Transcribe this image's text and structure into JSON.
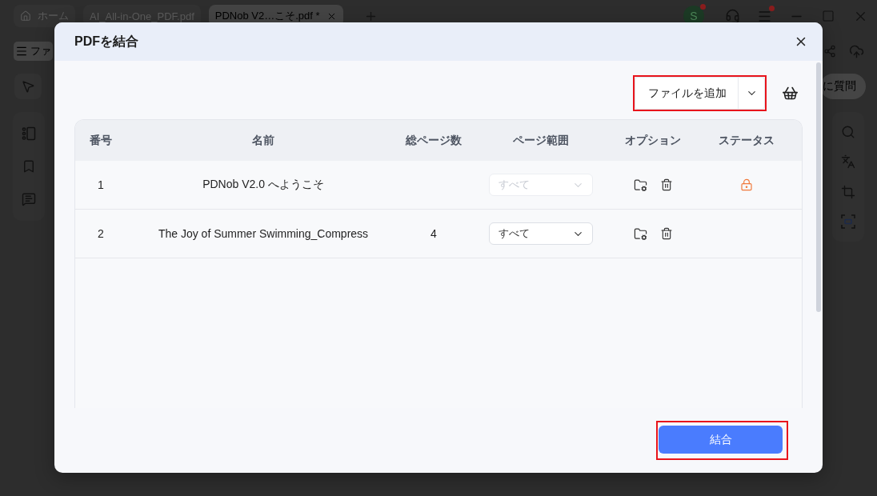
{
  "app": {
    "tabs": [
      {
        "label": "ホーム",
        "kind": "home",
        "selected": false
      },
      {
        "label": "AI_All-in-One_PDF.pdf",
        "kind": "file",
        "selected": false
      },
      {
        "label": "PDNob V2…こそ.pdf *",
        "kind": "file",
        "selected": true
      }
    ],
    "account": {
      "initial": "S",
      "notification": true
    },
    "menu_notification": true,
    "file_menu": {
      "label": "ファ"
    },
    "ask_button": {
      "label": "に質問"
    }
  },
  "dialog": {
    "title": "PDFを結合",
    "add_files": {
      "label": "ファイルを追加",
      "highlighted": true
    },
    "table": {
      "columns": [
        "番号",
        "名前",
        "総ページ数",
        "ページ範囲",
        "オプション",
        "ステータス"
      ],
      "rows": [
        {
          "number": "1",
          "name": "PDNob V2.0 へようこそ",
          "page_range": {
            "value": "すべて",
            "disabled": true
          },
          "locked": true
        },
        {
          "number": "2",
          "name": "The Joy of Summer Swimming_Compress",
          "total_pages": "4",
          "page_range": {
            "value": "すべて",
            "disabled": false
          },
          "locked": false
        }
      ]
    },
    "merge_button": {
      "label": "結合",
      "highlighted": true
    }
  }
}
